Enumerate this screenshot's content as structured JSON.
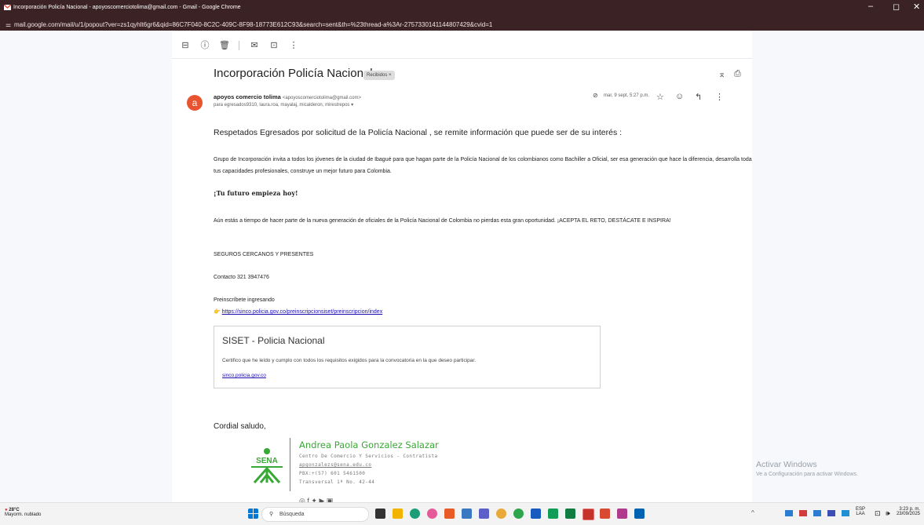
{
  "window": {
    "title": "Incorporación Policía Nacional - apoyoscomerciotolima@gmail.com - Gmail - Google Chrome",
    "url": "mail.google.com/mail/u/1/popout?ver=zs1qyhlt6gr6&qid=86C7F040-8C2C-409C-8F98-18773E612C93&search=sent&th=%23thread-a%3Ar-2757330141144807429&cvid=1"
  },
  "email": {
    "subject": "Incorporación Policía Nacional",
    "label": "Recibidos ×",
    "sender_name": "apoyos comercio tolima",
    "sender_email": "<apoyoscomerciotolima@gmail.com>",
    "recipients": "para egresados9310, laura.roa, mayalaj, micalderon, mirestrepos ▾",
    "date": "mar, 9 sept, 5:27 p.m.",
    "avatar_letter": "a",
    "greeting": "Respetados Egresados por solicitud de la Policía Nacional , se remite información que puede ser de su interés :",
    "paragraph1": "Grupo de Incorporación invita a todos los jóvenes de la ciudad de Ibagué para que hagan parte de la Policía Nacional de los colombianos como Bachiller a Oficial, ser esa generación que hace la diferencia, desarrolla todas tus capacidades profesionales, construye un mejor futuro para Colombia.",
    "slogan": "¡Tu futuro empieza hoy!",
    "paragraph2": "Aún estás a tiempo de hacer parte de la nueva generación de oficiales de la Policía Nacional de Colombia no pierdas esta gran oportunidad. ¡ACEPTA EL RETO, DESTÁCATE E INSPIRA!",
    "seguros": "SEGUROS CERCANOS Y PRESENTES",
    "contacto": "Contacto 321 3947476",
    "preinscribete": "Preinscríbete ingresando",
    "pointer": "👉",
    "link": "https://sinco.policia.gov.co/preinscripcionsiset/preinscripcion/index",
    "card": {
      "title": "SISET - Policia Nacional",
      "description": "Certifico que he leído y cumplo con todos los requisitos exigidos para la convocatoria en la que deseo participar.",
      "domain": "sinco.policia.gov.co"
    },
    "signoff": "Cordial saludo,",
    "signature": {
      "name": "Andrea Paola Gonzalez Salazar",
      "role": "Centro De Comercio Y Servicios - Contratista",
      "email": "apgonzalezs@sena.edu.co",
      "phone": "PBX:+(57) 601 5461500",
      "address": "Transversal 1ª No. 42-44",
      "logo_text": "SENA"
    }
  },
  "watermark": {
    "line1": "Activar Windows",
    "line2": "Ve a Configuración para activar Windows."
  },
  "taskbar": {
    "weather_temp": "28°C",
    "weather_desc": "Mayorm. nublado",
    "search_placeholder": "Búsqueda",
    "lang_top": "ESP",
    "lang_bottom": "LAA",
    "time": "3:23 p. m.",
    "date": "23/09/2025"
  },
  "colors": {
    "titlebar": "#3b2224",
    "avatar": "#e8542f",
    "sena_green": "#39a935",
    "link": "#1a0dab"
  }
}
